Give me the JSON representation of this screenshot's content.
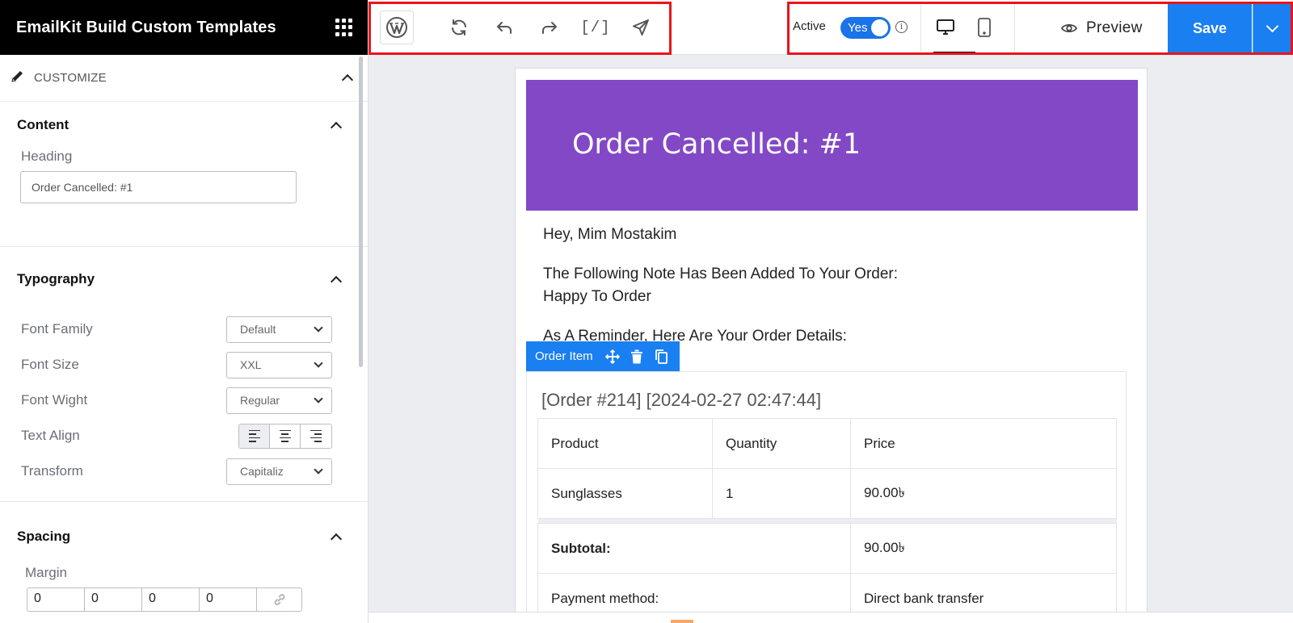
{
  "sidebar": {
    "title": "EmailKit Build Custom Templates",
    "customize_label": "CUSTOMIZE",
    "content": {
      "title": "Content",
      "heading_label": "Heading",
      "heading_value": "Order Cancelled: #1"
    },
    "typography": {
      "title": "Typography",
      "font_family_label": "Font Family",
      "font_family_value": "Default",
      "font_size_label": "Font Size",
      "font_size_value": "XXL",
      "font_weight_label": "Font Wight",
      "font_weight_value": "Regular",
      "text_align_label": "Text Align",
      "text_align_value": "left",
      "transform_label": "Transform",
      "transform_value": "Capitaliz"
    },
    "spacing": {
      "title": "Spacing",
      "margin_label": "Margin",
      "margin_values": [
        "0",
        "0",
        "0",
        "0"
      ]
    }
  },
  "toolbar": {
    "active_label": "Active",
    "toggle_value": "Yes",
    "shortcode_label": "[/]",
    "preview_label": "Preview",
    "save_label": "Save",
    "selected_device": "desktop",
    "highlight_color": "#e8141c",
    "accent_color": "#1a7ff0"
  },
  "email": {
    "banner_title": "Order Cancelled: #1",
    "banner_color": "#8248c6",
    "greeting": "Hey, Mim Mostakim",
    "note_line1": "The Following Note Has Been Added To Your Order:",
    "note_line2": "Happy To Order",
    "reminder": "As A Reminder, Here Are Your Order Details:",
    "order_item_tag": "Order Item",
    "order_heading": "[Order #214] [2024-02-27 02:47:44]",
    "table": {
      "headers": [
        "Product",
        "Quantity",
        "Price"
      ],
      "rows": [
        [
          "Sunglasses",
          "1",
          "90.00৳"
        ]
      ],
      "subtotal_label": "Subtotal:",
      "subtotal_value": "90.00৳",
      "payment_label": "Payment method:",
      "payment_value": "Direct bank transfer"
    }
  }
}
